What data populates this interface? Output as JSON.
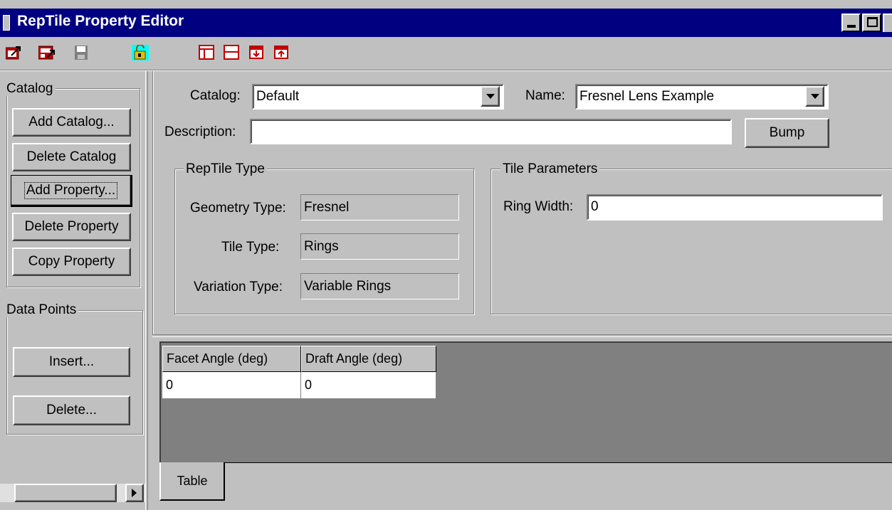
{
  "window": {
    "title": "RepTile Property Editor"
  },
  "toolbar": {
    "left_icons": [
      "export-icon",
      "import-icon",
      "save-icon",
      "lock-icon"
    ],
    "right_icons": [
      "layout-split-icon",
      "layout-horizontal-icon",
      "insert-row-below-icon",
      "insert-row-above-icon"
    ]
  },
  "sidebar": {
    "catalog_group": "Catalog",
    "buttons": {
      "add_catalog": "Add Catalog...",
      "delete_catalog": "Delete Catalog",
      "add_property": "Add Property...",
      "delete_property": "Delete Property",
      "copy_property": "Copy Property"
    },
    "data_points_group": "Data Points",
    "insert": "Insert...",
    "delete": "Delete..."
  },
  "form": {
    "catalog_label": "Catalog:",
    "catalog_value": "Default",
    "name_label": "Name:",
    "name_value": "Fresnel Lens Example",
    "description_label": "Description:",
    "description_value": "",
    "bump_button": "Bump"
  },
  "reptile_type": {
    "group_label": "RepTile Type",
    "geometry_label": "Geometry Type:",
    "geometry_value": "Fresnel",
    "tile_label": "Tile Type:",
    "tile_value": "Rings",
    "variation_label": "Variation Type:",
    "variation_value": "Variable Rings"
  },
  "tile_parameters": {
    "group_label": "Tile Parameters",
    "ring_width_label": "Ring Width:",
    "ring_width_value": "0"
  },
  "table": {
    "columns": [
      "Facet Angle (deg)",
      "Draft Angle (deg)"
    ],
    "rows": [
      [
        "0",
        "0"
      ]
    ],
    "tab_label": "Table"
  }
}
